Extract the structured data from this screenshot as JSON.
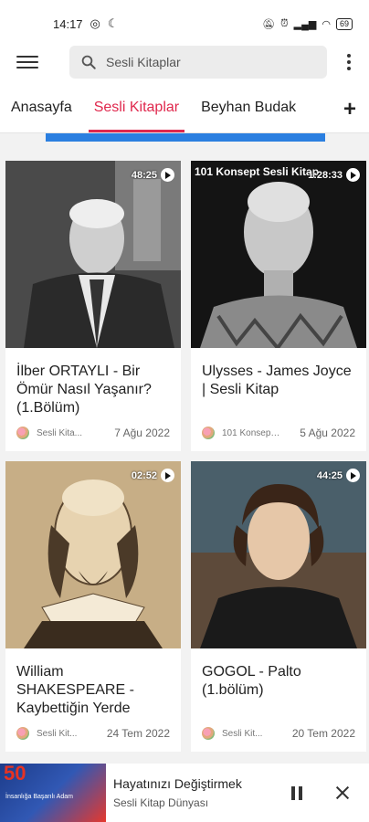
{
  "status": {
    "time": "14:17",
    "battery": "69"
  },
  "search": {
    "placeholder": "Sesli Kitaplar"
  },
  "tabs": [
    {
      "label": "Anasayfa"
    },
    {
      "label": "Sesli Kitaplar"
    },
    {
      "label": "Beyhan Budak"
    }
  ],
  "plus_label": "+",
  "videos": [
    {
      "duration": "48:25",
      "title": "İlber ORTAYLI - Bir Ömür Nasıl Yaşanır? (1.Bölüm)",
      "channel": "Sesli Kita...",
      "date": "7 Ağu 2022"
    },
    {
      "duration": "1:28:33",
      "overlay": "101 Konsept Sesli Kitap",
      "title": "Ulysses - James Joyce | Sesli Kitap",
      "channel": "101 Konsept...",
      "date": "5 Ağu 2022"
    },
    {
      "duration": "02:52",
      "title": "William SHAKESPEARE - Kaybettiğin Yerde",
      "channel": "Sesli Kit...",
      "date": "24 Tem 2022"
    },
    {
      "duration": "44:25",
      "title": "GOGOL - Palto (1.bölüm)",
      "channel": "Sesli Kit...",
      "date": "20 Tem 2022"
    }
  ],
  "mini_player": {
    "thumb_big": "50",
    "thumb_small": "İnsanlığa Başarılı Adam",
    "title": "Hayatınızı Değiştirmek",
    "subtitle": "Sesli Kitap Dünyası"
  }
}
